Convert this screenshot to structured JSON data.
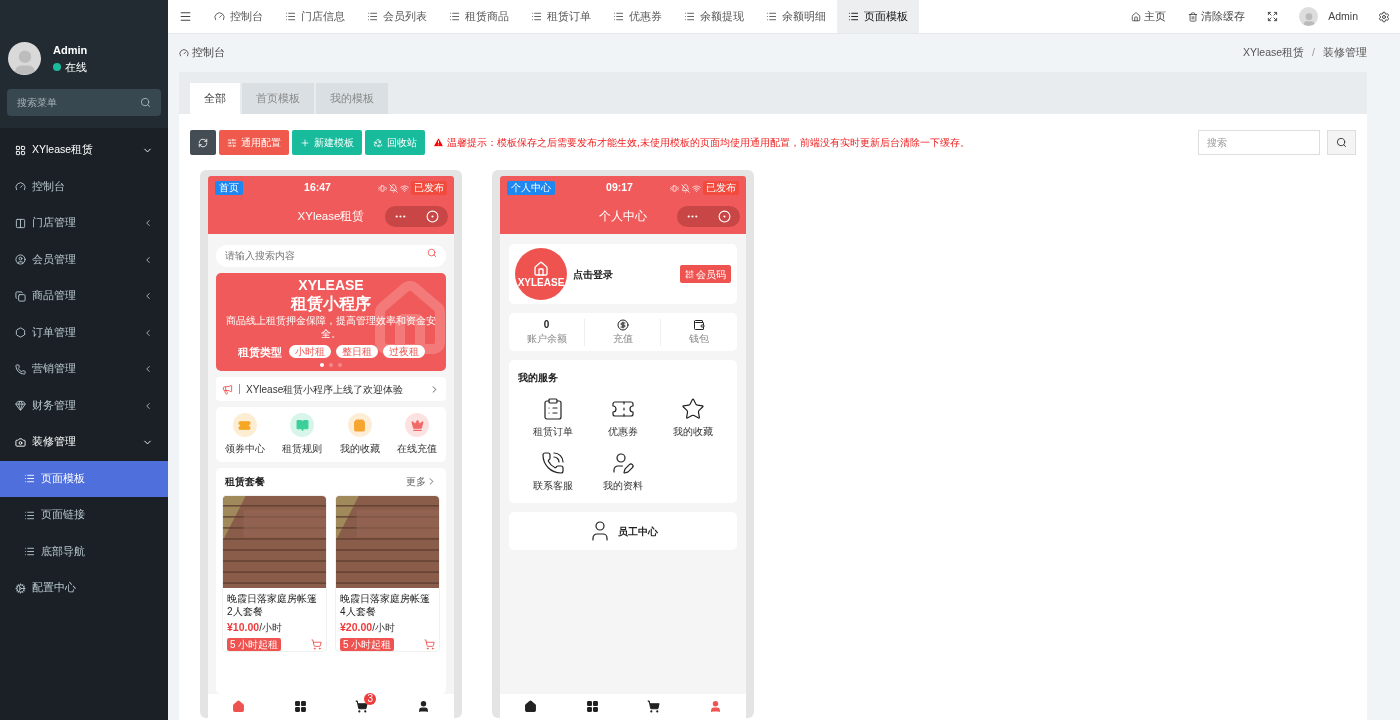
{
  "sidebar": {
    "user": {
      "name": "Admin",
      "status": "在线"
    },
    "search": {
      "placeholder": "搜索菜单"
    },
    "menu": [
      {
        "label": "XYlease租赁",
        "kind": "header",
        "expanded": true,
        "selected": false
      },
      {
        "label": "控制台",
        "kind": "item",
        "selected": false
      },
      {
        "label": "门店管理",
        "kind": "folder",
        "expanded": false,
        "selected": false
      },
      {
        "label": "会员管理",
        "kind": "folder",
        "expanded": false,
        "selected": false
      },
      {
        "label": "商品管理",
        "kind": "folder",
        "expanded": false,
        "selected": false
      },
      {
        "label": "订单管理",
        "kind": "folder",
        "expanded": false,
        "selected": false
      },
      {
        "label": "营销管理",
        "kind": "folder",
        "expanded": false,
        "selected": false
      },
      {
        "label": "财务管理",
        "kind": "folder",
        "expanded": false,
        "selected": false
      },
      {
        "label": "装修管理",
        "kind": "folder",
        "expanded": true,
        "selected": false,
        "children": [
          {
            "label": "页面模板",
            "selected": true
          },
          {
            "label": "页面链接",
            "selected": false
          },
          {
            "label": "底部导航",
            "selected": false
          }
        ]
      },
      {
        "label": "配置中心",
        "kind": "item",
        "selected": false
      }
    ]
  },
  "topnav": {
    "tabs": [
      {
        "label": "控制台",
        "selected": false
      },
      {
        "label": "门店信息",
        "selected": false
      },
      {
        "label": "会员列表",
        "selected": false
      },
      {
        "label": "租赁商品",
        "selected": false
      },
      {
        "label": "租赁订单",
        "selected": false
      },
      {
        "label": "优惠券",
        "selected": false
      },
      {
        "label": "余额提现",
        "selected": false
      },
      {
        "label": "余额明细",
        "selected": false
      },
      {
        "label": "页面模板",
        "selected": true
      }
    ],
    "links": [
      "主页",
      "清除缓存"
    ],
    "user": "Admin"
  },
  "breadcrumb": {
    "title": "控制台",
    "path": [
      "XYlease租赁",
      "装修管理"
    ],
    "separator": "/"
  },
  "panel": {
    "tabs": [
      {
        "label": "全部",
        "selected": true
      },
      {
        "label": "首页模板",
        "selected": false
      },
      {
        "label": "我的模板",
        "selected": false
      }
    ],
    "toolbar": [
      {
        "kind": "refresh"
      },
      {
        "kind": "config",
        "label": "通用配置"
      },
      {
        "kind": "add",
        "label": "新建模板"
      },
      {
        "kind": "recycle",
        "label": "回收站"
      }
    ],
    "notice": "温馨提示：模板保存之后需要发布才能生效,未使用模板的页面均使用通用配置，前端没有实时更新后台清除一下缓存。",
    "search": {
      "placeholder": "搜索"
    }
  },
  "templates": [
    {
      "kind": "home",
      "tag": "首页",
      "time": "16:47",
      "status": "已发布",
      "title": "XYlease租赁",
      "search": {
        "placeholder": "请输入搜索内容"
      },
      "banner": {
        "brand": "XYLEASE",
        "headline": "租赁小程序",
        "tagline": "商品线上租赁押金保障，提高管理效率和资金安全。",
        "types_label": "租赁类型",
        "types": [
          "小时租",
          "整日租",
          "过夜租"
        ]
      },
      "notice": "XYlease租赁小程序上线了欢迎体验",
      "shortcuts": [
        {
          "label": "领券中心",
          "color": "#f5a623"
        },
        {
          "label": "租赁规则",
          "color": "#3ccf9a"
        },
        {
          "label": "我的收藏",
          "color": "#f7a531"
        },
        {
          "label": "在线充值",
          "color": "#f06a6a"
        }
      ],
      "section": {
        "title": "租赁套餐",
        "more": "更多"
      },
      "products": [
        {
          "name": "晚霞日落家庭房帐篷2人套餐",
          "price": "¥10.00",
          "unit": "/小时",
          "tag": "5 小时起租"
        },
        {
          "name": "晚霞日落家庭房帐篷4人套餐",
          "price": "¥20.00",
          "unit": "/小时",
          "tag": "5 小时起租"
        }
      ],
      "tabbar": [
        {
          "selected": true
        },
        {
          "selected": false
        },
        {
          "selected": false,
          "badge": "3"
        },
        {
          "selected": false
        }
      ]
    },
    {
      "kind": "profile",
      "tag": "个人中心",
      "time": "09:17",
      "status": "已发布",
      "title": "个人中心",
      "account": {
        "logo": "XYLEASE",
        "login": "点击登录",
        "code_button": "会员码"
      },
      "stats": [
        {
          "kind": "value",
          "value": "0",
          "label": "账户余额"
        },
        {
          "kind": "icon",
          "label": "充值"
        },
        {
          "kind": "icon",
          "label": "钱包"
        }
      ],
      "services": {
        "title": "我的服务",
        "items": [
          "租赁订单",
          "优惠券",
          "我的收藏",
          "联系客服",
          "我的资料"
        ]
      },
      "staff": "员工中心",
      "tabbar": [
        {
          "selected": false
        },
        {
          "selected": false
        },
        {
          "selected": false
        },
        {
          "selected": true
        }
      ]
    }
  ]
}
